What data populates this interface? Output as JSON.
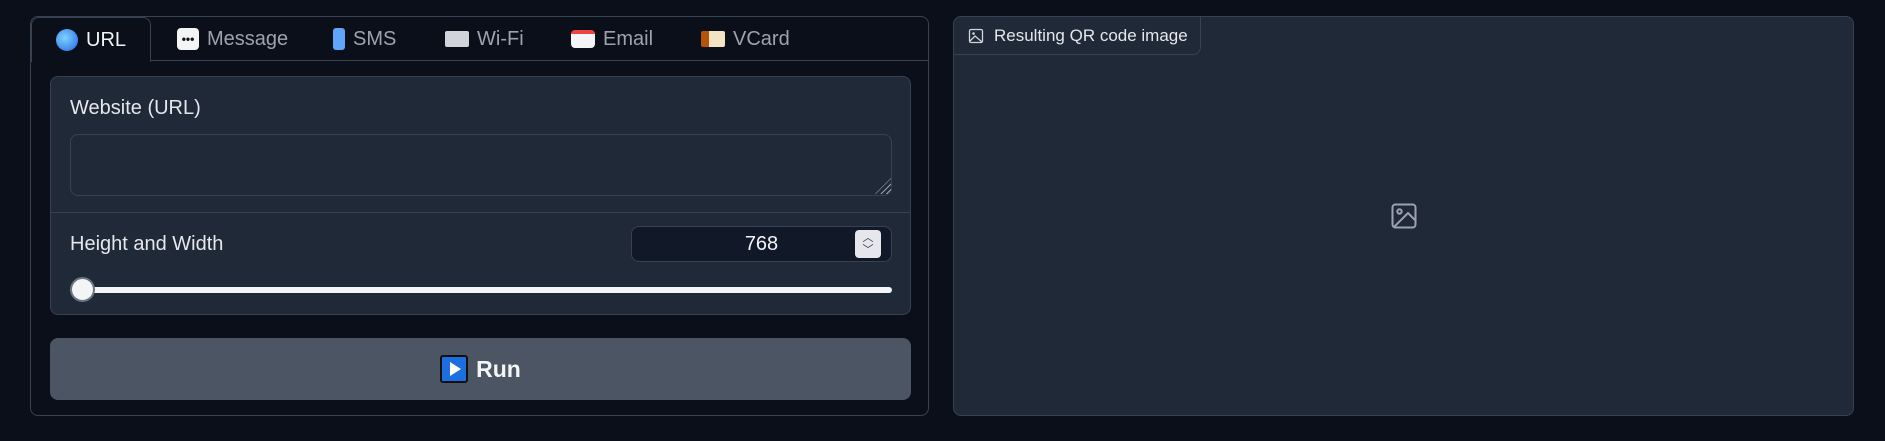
{
  "tabs": [
    {
      "label": "URL",
      "icon": "globe-icon",
      "active": true
    },
    {
      "label": "Message",
      "icon": "speech-bubble-icon",
      "active": false
    },
    {
      "label": "SMS",
      "icon": "mobile-phone-icon",
      "active": false
    },
    {
      "label": "Wi-Fi",
      "icon": "radio-icon",
      "active": false
    },
    {
      "label": "Email",
      "icon": "mailbox-icon",
      "active": false
    },
    {
      "label": "VCard",
      "icon": "id-card-icon",
      "active": false
    }
  ],
  "url_field": {
    "label": "Website (URL)",
    "value": ""
  },
  "size_field": {
    "label": "Height and Width",
    "value": "768"
  },
  "run_button": {
    "label": "Run",
    "icon": "play-button-icon"
  },
  "output": {
    "label": "Resulting QR code image",
    "icon": "image-icon"
  },
  "colors": {
    "background": "#0b0f19",
    "panel": "#1f2937",
    "border": "#374151",
    "button": "#4b5563"
  }
}
